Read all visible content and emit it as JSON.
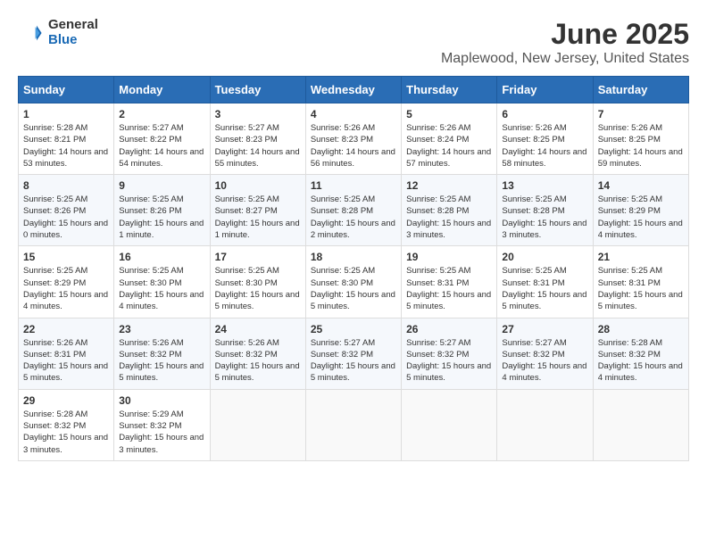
{
  "header": {
    "logo_general": "General",
    "logo_blue": "Blue",
    "title": "June 2025",
    "subtitle": "Maplewood, New Jersey, United States"
  },
  "calendar": {
    "days_of_week": [
      "Sunday",
      "Monday",
      "Tuesday",
      "Wednesday",
      "Thursday",
      "Friday",
      "Saturday"
    ],
    "weeks": [
      [
        {
          "day": "1",
          "sunrise": "5:28 AM",
          "sunset": "8:21 PM",
          "daylight": "14 hours and 53 minutes."
        },
        {
          "day": "2",
          "sunrise": "5:27 AM",
          "sunset": "8:22 PM",
          "daylight": "14 hours and 54 minutes."
        },
        {
          "day": "3",
          "sunrise": "5:27 AM",
          "sunset": "8:23 PM",
          "daylight": "14 hours and 55 minutes."
        },
        {
          "day": "4",
          "sunrise": "5:26 AM",
          "sunset": "8:23 PM",
          "daylight": "14 hours and 56 minutes."
        },
        {
          "day": "5",
          "sunrise": "5:26 AM",
          "sunset": "8:24 PM",
          "daylight": "14 hours and 57 minutes."
        },
        {
          "day": "6",
          "sunrise": "5:26 AM",
          "sunset": "8:25 PM",
          "daylight": "14 hours and 58 minutes."
        },
        {
          "day": "7",
          "sunrise": "5:26 AM",
          "sunset": "8:25 PM",
          "daylight": "14 hours and 59 minutes."
        }
      ],
      [
        {
          "day": "8",
          "sunrise": "5:25 AM",
          "sunset": "8:26 PM",
          "daylight": "15 hours and 0 minutes."
        },
        {
          "day": "9",
          "sunrise": "5:25 AM",
          "sunset": "8:26 PM",
          "daylight": "15 hours and 1 minute."
        },
        {
          "day": "10",
          "sunrise": "5:25 AM",
          "sunset": "8:27 PM",
          "daylight": "15 hours and 1 minute."
        },
        {
          "day": "11",
          "sunrise": "5:25 AM",
          "sunset": "8:28 PM",
          "daylight": "15 hours and 2 minutes."
        },
        {
          "day": "12",
          "sunrise": "5:25 AM",
          "sunset": "8:28 PM",
          "daylight": "15 hours and 3 minutes."
        },
        {
          "day": "13",
          "sunrise": "5:25 AM",
          "sunset": "8:28 PM",
          "daylight": "15 hours and 3 minutes."
        },
        {
          "day": "14",
          "sunrise": "5:25 AM",
          "sunset": "8:29 PM",
          "daylight": "15 hours and 4 minutes."
        }
      ],
      [
        {
          "day": "15",
          "sunrise": "5:25 AM",
          "sunset": "8:29 PM",
          "daylight": "15 hours and 4 minutes."
        },
        {
          "day": "16",
          "sunrise": "5:25 AM",
          "sunset": "8:30 PM",
          "daylight": "15 hours and 4 minutes."
        },
        {
          "day": "17",
          "sunrise": "5:25 AM",
          "sunset": "8:30 PM",
          "daylight": "15 hours and 5 minutes."
        },
        {
          "day": "18",
          "sunrise": "5:25 AM",
          "sunset": "8:30 PM",
          "daylight": "15 hours and 5 minutes."
        },
        {
          "day": "19",
          "sunrise": "5:25 AM",
          "sunset": "8:31 PM",
          "daylight": "15 hours and 5 minutes."
        },
        {
          "day": "20",
          "sunrise": "5:25 AM",
          "sunset": "8:31 PM",
          "daylight": "15 hours and 5 minutes."
        },
        {
          "day": "21",
          "sunrise": "5:25 AM",
          "sunset": "8:31 PM",
          "daylight": "15 hours and 5 minutes."
        }
      ],
      [
        {
          "day": "22",
          "sunrise": "5:26 AM",
          "sunset": "8:31 PM",
          "daylight": "15 hours and 5 minutes."
        },
        {
          "day": "23",
          "sunrise": "5:26 AM",
          "sunset": "8:32 PM",
          "daylight": "15 hours and 5 minutes."
        },
        {
          "day": "24",
          "sunrise": "5:26 AM",
          "sunset": "8:32 PM",
          "daylight": "15 hours and 5 minutes."
        },
        {
          "day": "25",
          "sunrise": "5:27 AM",
          "sunset": "8:32 PM",
          "daylight": "15 hours and 5 minutes."
        },
        {
          "day": "26",
          "sunrise": "5:27 AM",
          "sunset": "8:32 PM",
          "daylight": "15 hours and 5 minutes."
        },
        {
          "day": "27",
          "sunrise": "5:27 AM",
          "sunset": "8:32 PM",
          "daylight": "15 hours and 4 minutes."
        },
        {
          "day": "28",
          "sunrise": "5:28 AM",
          "sunset": "8:32 PM",
          "daylight": "15 hours and 4 minutes."
        }
      ],
      [
        {
          "day": "29",
          "sunrise": "5:28 AM",
          "sunset": "8:32 PM",
          "daylight": "15 hours and 3 minutes."
        },
        {
          "day": "30",
          "sunrise": "5:29 AM",
          "sunset": "8:32 PM",
          "daylight": "15 hours and 3 minutes."
        },
        null,
        null,
        null,
        null,
        null
      ]
    ]
  }
}
